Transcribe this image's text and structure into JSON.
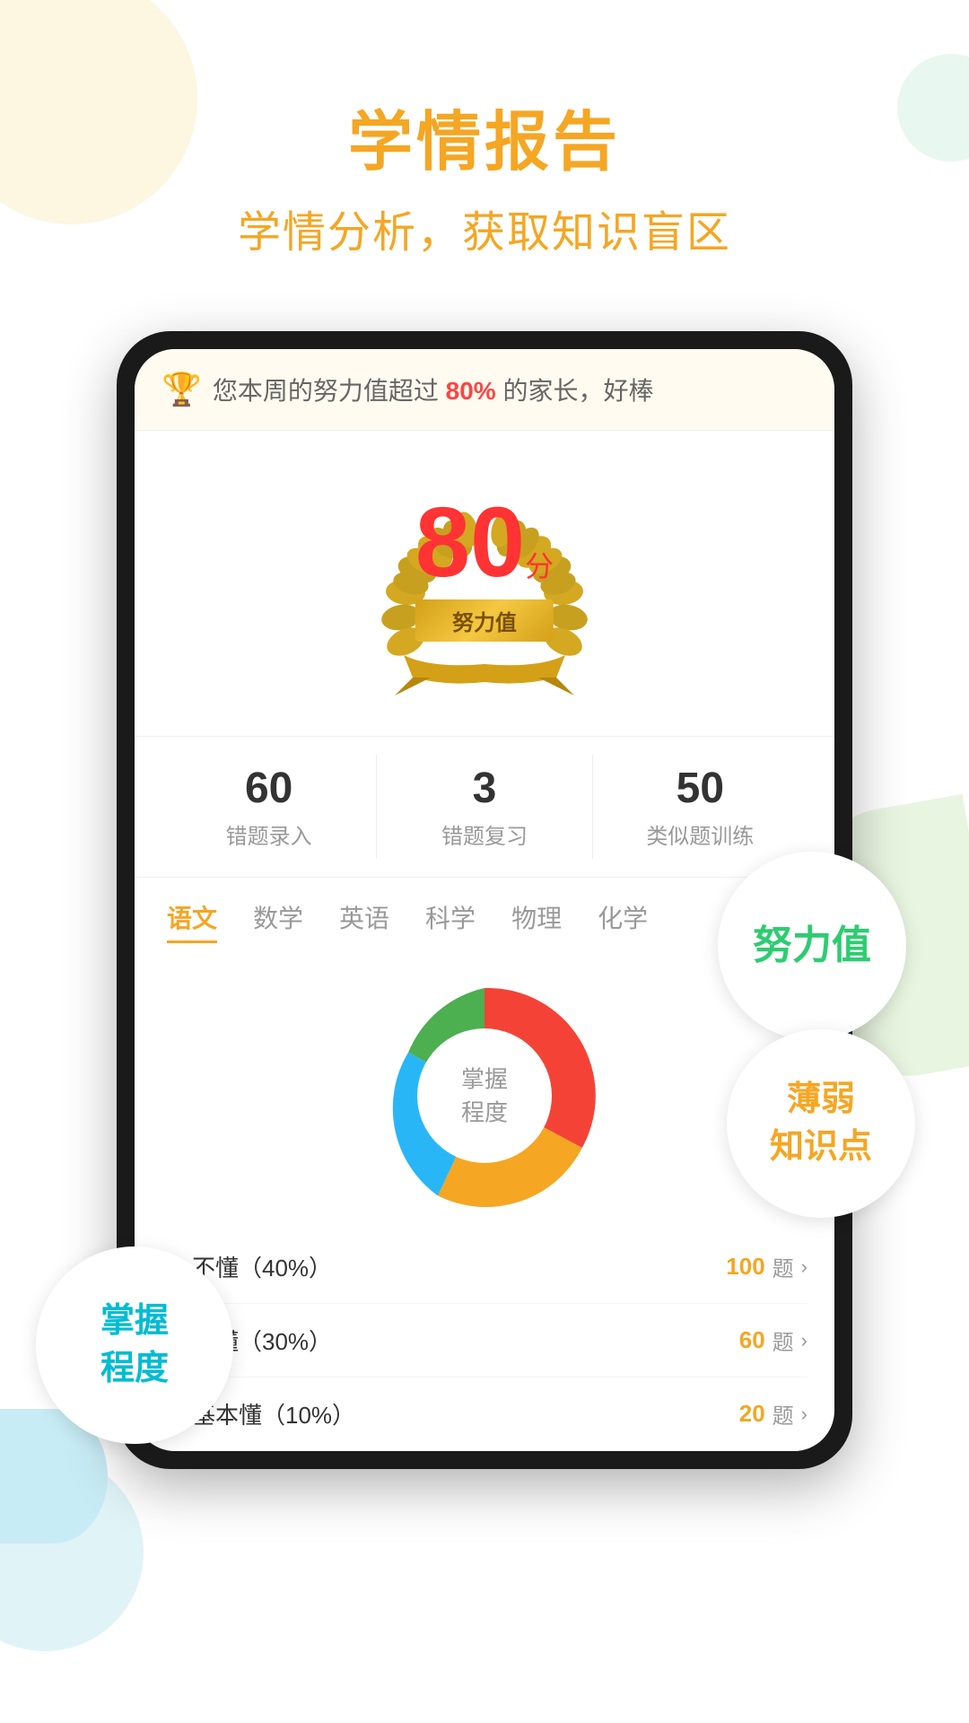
{
  "header": {
    "title": "学情报告",
    "subtitle": "学情分析，获取知识盲区"
  },
  "banner": {
    "text": "您本周的努力值超过",
    "highlight": "80%",
    "text2": "的家长，好棒"
  },
  "score": {
    "number": "80",
    "unit": "分",
    "label": "努力值"
  },
  "stats": [
    {
      "number": "60",
      "label": "错题录入"
    },
    {
      "number": "3",
      "label": "错题复习"
    },
    {
      "number": "50",
      "label": "类似题训练"
    }
  ],
  "subjects": [
    {
      "label": "语文",
      "active": true
    },
    {
      "label": "数学",
      "active": false
    },
    {
      "label": "英语",
      "active": false
    },
    {
      "label": "科学",
      "active": false
    },
    {
      "label": "物理",
      "active": false
    },
    {
      "label": "化学",
      "active": false
    }
  ],
  "chart": {
    "center_line1": "掌握",
    "center_line2": "程度",
    "segments": [
      {
        "label": "不懂",
        "percent": 40,
        "color": "#f44336",
        "startAngle": -90,
        "sweep": 144
      },
      {
        "label": "略懂",
        "percent": 30,
        "color": "#f5a623",
        "startAngle": 54,
        "sweep": 108
      },
      {
        "label": "基本懂",
        "percent": 10,
        "color": "#29b6f6",
        "startAngle": 162,
        "sweep": 36
      },
      {
        "label": "掌握",
        "percent": 20,
        "color": "#4caf50",
        "startAngle": 198,
        "sweep": 72
      }
    ]
  },
  "legend": [
    {
      "label": "不懂（40%）",
      "color": "#f44336",
      "count": "100",
      "unit": "题"
    },
    {
      "label": "略懂（30%）",
      "color": "#f5a623",
      "count": "60",
      "unit": "题"
    },
    {
      "label": "基本懂（10%）",
      "color": "#29b6f6",
      "count": "20",
      "unit": "题"
    }
  ],
  "floats": {
    "nulizhi": "努力值",
    "zhangwo": "掌握\n程度",
    "ruodian_line1": "薄弱",
    "ruodian_line2": "知识点"
  }
}
